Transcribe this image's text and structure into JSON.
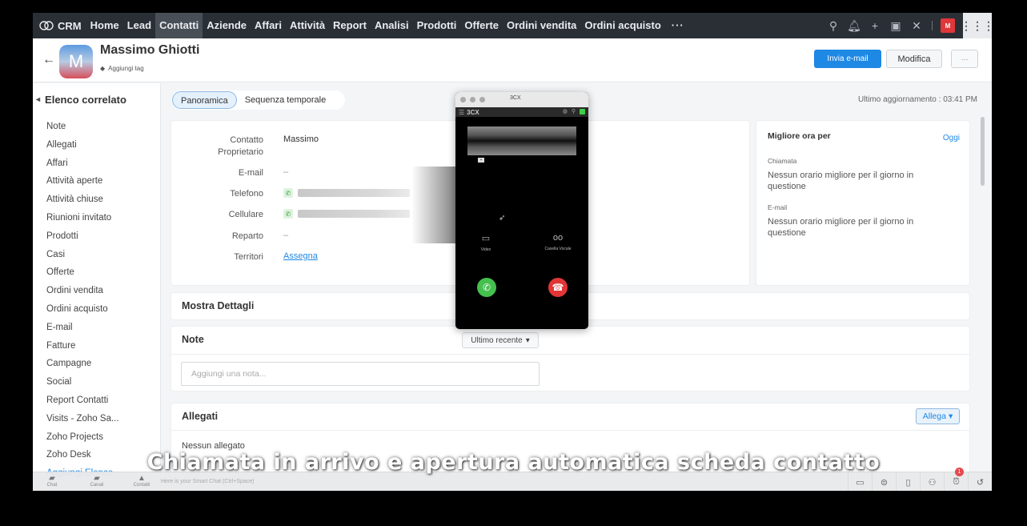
{
  "topnav": {
    "brand": "CRM",
    "items": [
      "Home",
      "Lead",
      "Contatti",
      "Aziende",
      "Affari",
      "Attività",
      "Report",
      "Analisi",
      "Prodotti",
      "Offerte",
      "Ordini vendita",
      "Ordini acquisto"
    ],
    "active": "Contatti",
    "more": "···",
    "icons": [
      "search-icon",
      "bell-icon",
      "plus-icon",
      "calendar-icon",
      "settings-icon",
      "user-avatar",
      "apps-grid-icon"
    ]
  },
  "record": {
    "avatar_letter": "M",
    "name": "Massimo Ghiotti",
    "add_tag": "Aggiungi tag",
    "send_email": "Invia e-mail",
    "edit": "Modifica",
    "more": "···"
  },
  "sidebar": {
    "title": "Elenco correlato",
    "items": [
      "Note",
      "Allegati",
      "Affari",
      "Attività aperte",
      "Attività chiuse",
      "Riunioni invitato",
      "Prodotti",
      "Casi",
      "Offerte",
      "Ordini vendita",
      "Ordini acquisto",
      "E-mail",
      "Fatture",
      "Campagne",
      "Social",
      "Report Contatti",
      "Visits - Zoho Sa...",
      "Zoho Projects",
      "Zoho Desk"
    ],
    "add_list": "Aggiungi Elenco"
  },
  "tabs": [
    "Panoramica",
    "Sequenza temporale"
  ],
  "last_update": "Ultimo aggiornamento : 03:41 PM",
  "overview": {
    "fields": [
      {
        "label": "Contatto Proprietario",
        "value": "Massimo"
      },
      {
        "label": "E-mail",
        "value": "–"
      },
      {
        "label": "Telefono",
        "value": "(blurred)"
      },
      {
        "label": "Cellulare",
        "value": "(blurred)"
      },
      {
        "label": "Reparto",
        "value": "–"
      },
      {
        "label": "Territori",
        "value": "Assegna"
      }
    ]
  },
  "best_time": {
    "title": "Migliore ora per",
    "today": "Oggi",
    "call_label": "Chiamata",
    "call_text": "Nessun orario migliore per il giorno in questione",
    "email_label": "E-mail",
    "email_text": "Nessun orario migliore per il giorno in questione"
  },
  "sections": {
    "details": "Mostra Dettagli",
    "notes": "Note",
    "notes_sort": "Ultimo recente",
    "notes_placeholder": "Aggiungi una nota...",
    "attachments": "Allegati",
    "attach_button": "Allega",
    "no_attachments": "Nessun allegato"
  },
  "bottombar": {
    "items": [
      "Chat",
      "Canali",
      "Contatti"
    ],
    "chat_hint": "Here is your Smart Chat (Ctrl+Space)",
    "notification_count": "1"
  },
  "phone_app": {
    "window_title": "3CX",
    "logo": "3CX",
    "video_label": "Video",
    "voicemail_label": "Casella Vocale"
  },
  "caption": "Chiamata in arrivo e apertura automatica scheda contatto"
}
